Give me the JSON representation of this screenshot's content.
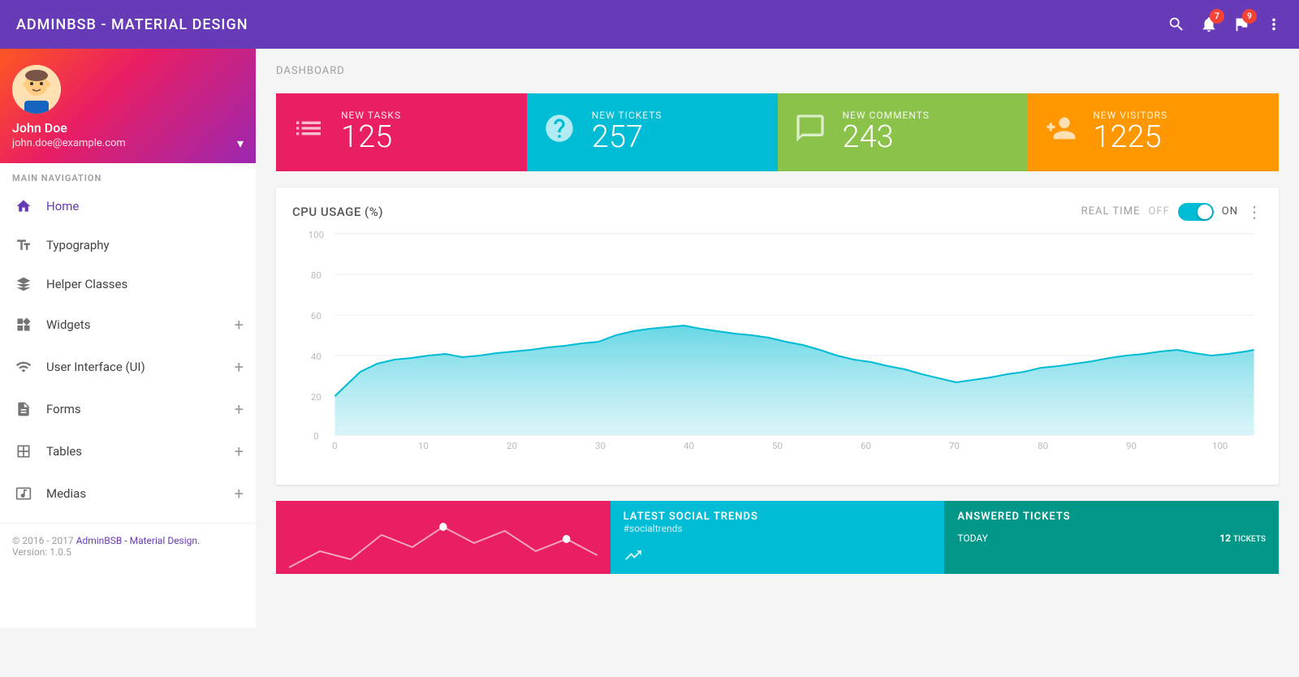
{
  "app": {
    "title": "ADMINBSB - MATERIAL DESIGN"
  },
  "topnav": {
    "notification_badge": "7",
    "flag_badge": "9"
  },
  "sidebar": {
    "user": {
      "name": "John Doe",
      "email": "john.doe@example.com"
    },
    "nav_label": "MAIN NAVIGATION",
    "items": [
      {
        "id": "home",
        "label": "Home",
        "icon": "home",
        "active": true,
        "has_plus": false
      },
      {
        "id": "typography",
        "label": "Typography",
        "icon": "typography",
        "active": false,
        "has_plus": false
      },
      {
        "id": "helper-classes",
        "label": "Helper Classes",
        "icon": "diamond",
        "active": false,
        "has_plus": false
      },
      {
        "id": "widgets",
        "label": "Widgets",
        "icon": "widgets",
        "active": false,
        "has_plus": true
      },
      {
        "id": "ui",
        "label": "User Interface (UI)",
        "icon": "ui",
        "active": false,
        "has_plus": true
      },
      {
        "id": "forms",
        "label": "Forms",
        "icon": "forms",
        "active": false,
        "has_plus": true
      },
      {
        "id": "tables",
        "label": "Tables",
        "icon": "tables",
        "active": false,
        "has_plus": true
      },
      {
        "id": "medias",
        "label": "Medias",
        "icon": "medias",
        "active": false,
        "has_plus": true
      }
    ],
    "footer": {
      "copyright": "© 2016 - 2017 ",
      "link_text": "AdminBSB - Material Design.",
      "version": "Version: 1.0.5"
    }
  },
  "main": {
    "page_title": "DASHBOARD",
    "stat_cards": [
      {
        "label": "NEW TASKS",
        "value": "125",
        "color": "pink"
      },
      {
        "label": "NEW TICKETS",
        "value": "257",
        "color": "teal"
      },
      {
        "label": "NEW COMMENTS",
        "value": "243",
        "color": "green"
      },
      {
        "label": "NEW VISITORS",
        "value": "1225",
        "color": "orange"
      }
    ],
    "chart": {
      "title": "CPU USAGE (%)",
      "realtime_label": "REAL TIME",
      "off_label": "OFF",
      "on_label": "ON",
      "y_axis": [
        100,
        80,
        60,
        40,
        20,
        0
      ],
      "x_axis": [
        0,
        10,
        20,
        30,
        40,
        50,
        60,
        70,
        80,
        90,
        100
      ]
    },
    "bottom": {
      "social_title": "LATEST SOCIAL TRENDS",
      "social_tag": "#socialtrends",
      "tickets_title": "ANSWERED TICKETS",
      "tickets_today": "TODAY",
      "tickets_count": "12",
      "tickets_unit": "TICKETS"
    }
  }
}
